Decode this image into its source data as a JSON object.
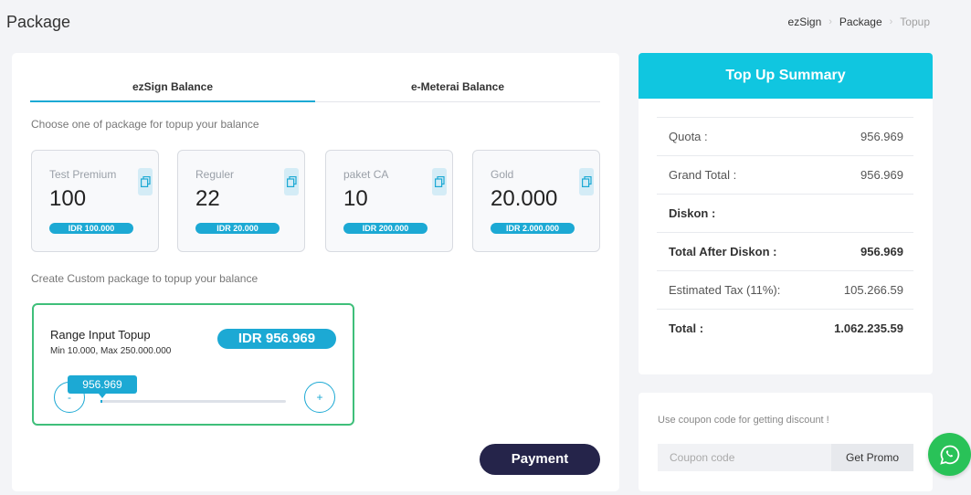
{
  "header": {
    "title": "Package",
    "breadcrumb": [
      "ezSign",
      "Package",
      "Topup"
    ]
  },
  "tabs": [
    {
      "label": "ezSign Balance",
      "active": true
    },
    {
      "label": "e-Meterai Balance",
      "active": false
    }
  ],
  "choose_hint": "Choose one of package for topup your balance",
  "packages": [
    {
      "name": "Test Premium",
      "qty": "100",
      "price": "IDR 100.000"
    },
    {
      "name": "Reguler",
      "qty": "22",
      "price": "IDR 20.000"
    },
    {
      "name": "paket CA",
      "qty": "10",
      "price": "IDR 200.000"
    },
    {
      "name": "Gold",
      "qty": "20.000",
      "price": "IDR 2.000.000"
    }
  ],
  "custom_hint": "Create Custom package to topup your balance",
  "custom": {
    "title": "Range Input Topup",
    "minmax": "Min 10.000, Max 250.000.000",
    "amount": "IDR 956.969",
    "slider_value": "956.969",
    "slider_fraction": 0.004,
    "minus_label": "-",
    "plus_label": "+"
  },
  "payment_label": "Payment",
  "summary": {
    "title": "Top Up Summary",
    "rows": [
      {
        "label": "Quota :",
        "value": "956.969",
        "bold": false
      },
      {
        "label": "Grand Total :",
        "value": "956.969",
        "bold": false
      },
      {
        "label": "Diskon :",
        "value": "",
        "bold": true
      },
      {
        "label": "Total After Diskon :",
        "value": "956.969",
        "bold": true
      },
      {
        "label": "Estimated Tax (11%):",
        "value": "105.266.59",
        "bold": false
      },
      {
        "label": "Total :",
        "value": "1.062.235.59",
        "bold": true
      }
    ]
  },
  "coupon": {
    "hint": "Use coupon code for getting discount !",
    "placeholder": "Coupon code",
    "button_label": "Get Promo"
  },
  "colors": {
    "accent": "#1ca9d4",
    "summary_header": "#10c6e0",
    "payment": "#25244a",
    "custom_border": "#3fbf7a",
    "whatsapp": "#29c258"
  },
  "icons": {
    "copy": "copy-icon",
    "whatsapp": "whatsapp-icon",
    "breadcrumb_sep": "chevron-right-icon"
  }
}
